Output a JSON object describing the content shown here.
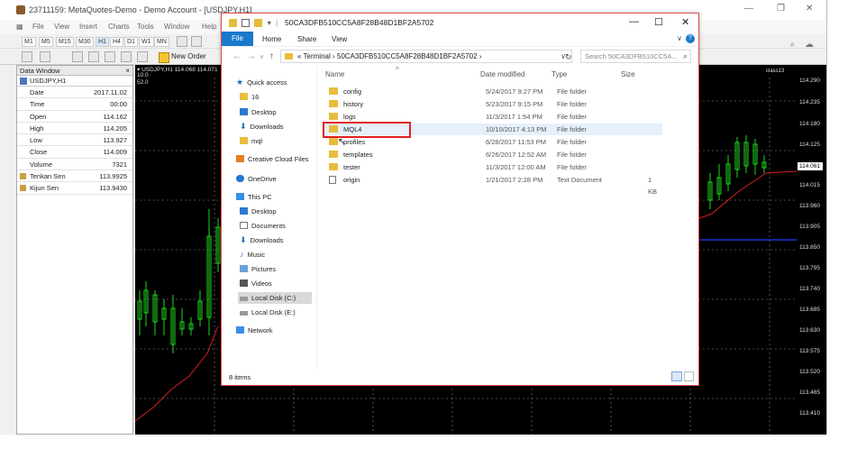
{
  "metatrader": {
    "title": "23711159: MetaQuotes-Demo - Demo Account - [USDJPY,H1]",
    "menu": [
      "File",
      "View",
      "Insert",
      "Charts",
      "Tools",
      "Window",
      "Help"
    ],
    "timeframes": [
      "M1",
      "M5",
      "M15",
      "M30",
      "H1",
      "H4",
      "D1",
      "W1",
      "MN"
    ],
    "new_order_label": "New Order",
    "data_window": {
      "title": "Data Window",
      "close": "×",
      "symbol": "USDJPY,H1",
      "rows": [
        {
          "label": "Date",
          "value": "2017.11.02"
        },
        {
          "label": "Time",
          "value": "00:00"
        },
        {
          "label": "Open",
          "value": "114.162"
        },
        {
          "label": "High",
          "value": "114.205"
        },
        {
          "label": "Low",
          "value": "113.927"
        },
        {
          "label": "Close",
          "value": "114.009"
        },
        {
          "label": "Volume",
          "value": "7321"
        },
        {
          "label": "Tenkan Sen",
          "value": "113.9925"
        },
        {
          "label": "Kijun Sen",
          "value": "113.9430"
        }
      ]
    },
    "chart": {
      "header": "▾ USDJPY,H1  114.068 114.071",
      "small_top": "10.0",
      "small_bottom": "52.0",
      "tag": "class13",
      "current_price": "114.061",
      "price_labels": [
        "114.290",
        "114.235",
        "114.180",
        "114.125",
        "114.015",
        "113.960",
        "113.905",
        "113.850",
        "113.795",
        "113.740",
        "113.685",
        "113.630",
        "113.575",
        "113.520",
        "113.465",
        "113.410"
      ]
    }
  },
  "explorer": {
    "title": "50CA3DFB510CC5A8F28B48D1BF2A5702",
    "controls": {
      "minimize": "—",
      "maximize": "☐",
      "close": "✕"
    },
    "ribbon": {
      "file": "File",
      "tabs": [
        "Home",
        "Share",
        "View"
      ],
      "help": "?",
      "expand": "∨"
    },
    "address": "«  Terminal  ›  50CA3DFB510CC5A8F28B48D1BF2A5702  ›",
    "search_placeholder": "Search 50CA3DFB510CC5A...",
    "nav_items": [
      {
        "label": "Quick access",
        "icon": "star"
      },
      {
        "label": "16",
        "icon": "folder"
      },
      {
        "label": "Desktop",
        "icon": "blue"
      },
      {
        "label": "Downloads",
        "icon": "down"
      },
      {
        "label": "mql",
        "icon": "folder"
      },
      {
        "label": "Creative Cloud Files",
        "icon": "cloud"
      },
      {
        "label": "OneDrive",
        "icon": "onedrive"
      },
      {
        "label": "This PC",
        "icon": "pc"
      },
      {
        "label": "Desktop",
        "icon": "blue"
      },
      {
        "label": "Documents",
        "icon": "doc"
      },
      {
        "label": "Downloads",
        "icon": "down"
      },
      {
        "label": "Music",
        "icon": "music"
      },
      {
        "label": "Pictures",
        "icon": "pic"
      },
      {
        "label": "Videos",
        "icon": "video"
      },
      {
        "label": "Local Disk (C:)",
        "icon": "disk"
      },
      {
        "label": "Local Disk (E:)",
        "icon": "disk"
      },
      {
        "label": "Network",
        "icon": "net"
      }
    ],
    "columns": {
      "name": "Name",
      "date": "Date modified",
      "type": "Type",
      "size": "Size"
    },
    "files": [
      {
        "name": "config",
        "date": "5/24/2017 9:27 PM",
        "type": "File folder",
        "size": "",
        "kind": "folder"
      },
      {
        "name": "history",
        "date": "5/23/2017 9:15 PM",
        "type": "File folder",
        "size": "",
        "kind": "folder"
      },
      {
        "name": "logs",
        "date": "11/3/2017 1:54 PM",
        "type": "File folder",
        "size": "",
        "kind": "folder"
      },
      {
        "name": "MQL4",
        "date": "10/10/2017 4:13 PM",
        "type": "File folder",
        "size": "",
        "kind": "folder"
      },
      {
        "name": "profiles",
        "date": "6/28/2017 11:53 PM",
        "type": "File folder",
        "size": "",
        "kind": "folder"
      },
      {
        "name": "templates",
        "date": "6/26/2017 12:52 AM",
        "type": "File folder",
        "size": "",
        "kind": "folder"
      },
      {
        "name": "tester",
        "date": "11/3/2017 12:00 AM",
        "type": "File folder",
        "size": "",
        "kind": "folder"
      },
      {
        "name": "origin",
        "date": "1/21/2017 2:28 PM",
        "type": "Text Document",
        "size": "1 KB",
        "kind": "file"
      }
    ],
    "status": "8 items"
  }
}
